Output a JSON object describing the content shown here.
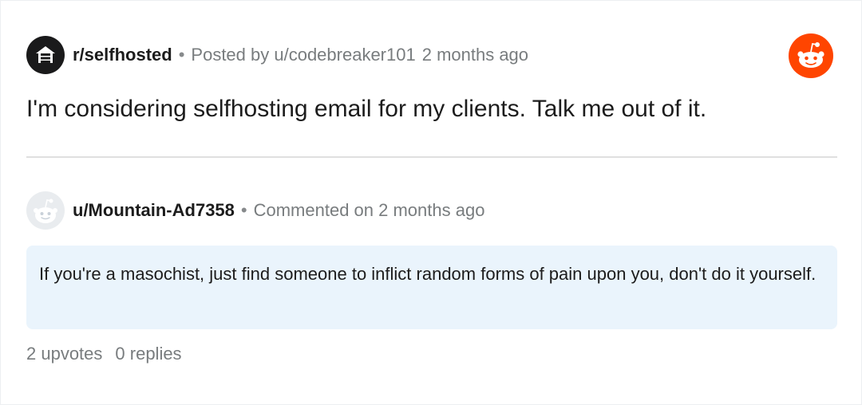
{
  "post": {
    "subreddit": "r/selfhosted",
    "separator": "•",
    "posted_by": "Posted by u/codebreaker101",
    "time": "2 months ago",
    "title": "I'm considering selfhosting email for my clients. Talk me out of it."
  },
  "comment": {
    "author": "u/Mountain-Ad7358",
    "separator": "•",
    "commented": "Commented on 2 months ago",
    "body": "If you're a masochist, just find someone to inflict random forms of pain upon you, don't do it yourself."
  },
  "stats": {
    "upvotes": "2 upvotes",
    "replies": "0 replies"
  },
  "colors": {
    "reddit_orange": "#ff4500",
    "comment_bg": "#eaf4fc",
    "meta_gray": "#787c7e"
  },
  "icons": {
    "subreddit": "server-rack-house-icon",
    "brand": "reddit-snoo-logo-icon",
    "avatar": "default-snoo-avatar-icon"
  }
}
